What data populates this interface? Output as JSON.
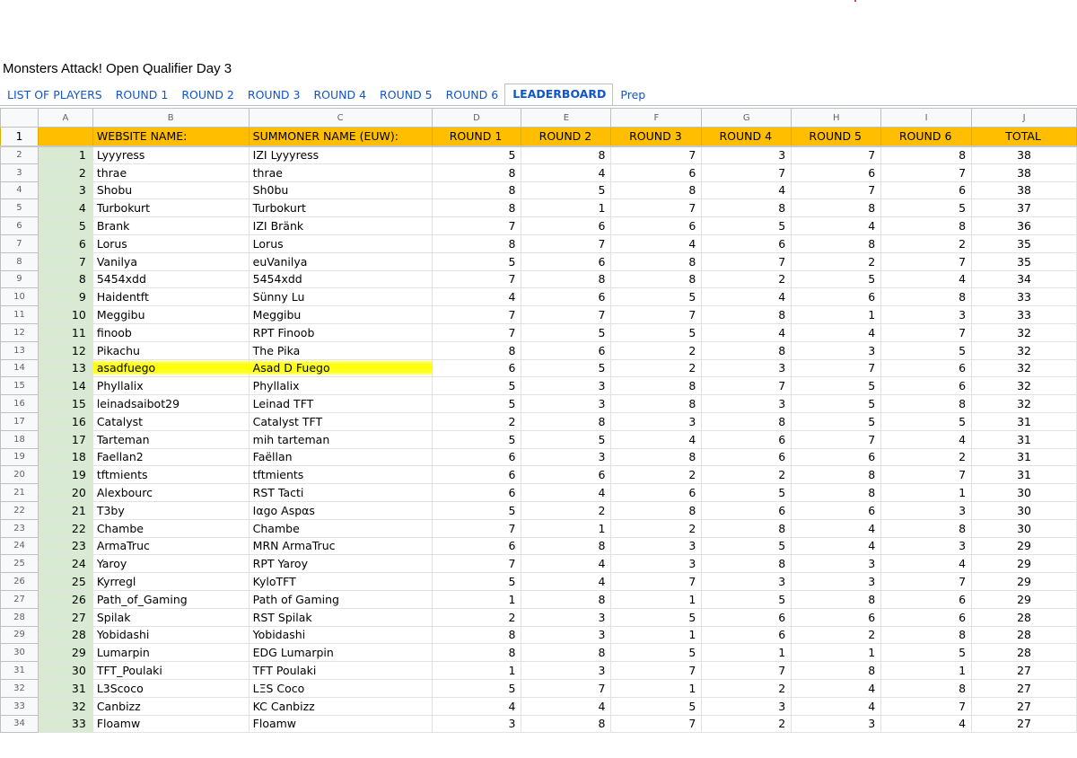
{
  "document": {
    "title": "Monsters Attack! Open Qualifier Day 3"
  },
  "tabs": [
    {
      "label": "LIST OF PLAYERS",
      "active": false
    },
    {
      "label": "ROUND 1",
      "active": false
    },
    {
      "label": "ROUND 2",
      "active": false
    },
    {
      "label": "ROUND 3",
      "active": false
    },
    {
      "label": "ROUND 4",
      "active": false
    },
    {
      "label": "ROUND 5",
      "active": false
    },
    {
      "label": "ROUND 6",
      "active": false
    },
    {
      "label": "LEADERBOARD",
      "active": true
    },
    {
      "label": "Prep",
      "active": false
    }
  ],
  "column_letters": [
    "A",
    "B",
    "C",
    "D",
    "E",
    "F",
    "G",
    "H",
    "I",
    "J"
  ],
  "headers": [
    "",
    "WEBSITE NAME:",
    "SUMMONER NAME (EUW):",
    "ROUND 1",
    "ROUND 2",
    "ROUND 3",
    "ROUND 4",
    "ROUND 5",
    "ROUND 6",
    "TOTAL"
  ],
  "highlight_color": "#ffff00",
  "header_color": "#ffbf00",
  "rank_color": "#d9ead3",
  "rows": [
    {
      "row": 2,
      "rank": 1,
      "website": "Lyyyress",
      "summoner": "IZI Lyyyress",
      "rounds": [
        5,
        8,
        7,
        3,
        7,
        8
      ],
      "total": 38
    },
    {
      "row": 3,
      "rank": 2,
      "website": "thrae",
      "summoner": "thrae",
      "rounds": [
        8,
        4,
        6,
        7,
        6,
        7
      ],
      "total": 38
    },
    {
      "row": 4,
      "rank": 3,
      "website": "Shobu",
      "summoner": "Sh0bu",
      "rounds": [
        8,
        5,
        8,
        4,
        7,
        6
      ],
      "total": 38
    },
    {
      "row": 5,
      "rank": 4,
      "website": "Turbokurt",
      "summoner": "Turbokurt",
      "rounds": [
        8,
        1,
        7,
        8,
        8,
        5
      ],
      "total": 37
    },
    {
      "row": 6,
      "rank": 5,
      "website": "Brank",
      "summoner": "IZI Bränk",
      "rounds": [
        7,
        6,
        6,
        5,
        4,
        8
      ],
      "total": 36
    },
    {
      "row": 7,
      "rank": 6,
      "website": "Lorus",
      "summoner": "Lorus",
      "rounds": [
        8,
        7,
        4,
        6,
        8,
        2
      ],
      "total": 35
    },
    {
      "row": 8,
      "rank": 7,
      "website": "Vanilya",
      "summoner": "euVanilya",
      "rounds": [
        5,
        6,
        8,
        7,
        2,
        7
      ],
      "total": 35
    },
    {
      "row": 9,
      "rank": 8,
      "website": "5454xdd",
      "summoner": "5454xdd",
      "rounds": [
        7,
        8,
        8,
        2,
        5,
        4
      ],
      "total": 34
    },
    {
      "row": 10,
      "rank": 9,
      "website": "Haidentft",
      "summoner": "Sünny Lu",
      "rounds": [
        4,
        6,
        5,
        4,
        6,
        8
      ],
      "total": 33
    },
    {
      "row": 11,
      "rank": 10,
      "website": "Meggibu",
      "summoner": "Meggibu",
      "rounds": [
        7,
        7,
        7,
        8,
        1,
        3
      ],
      "total": 33
    },
    {
      "row": 12,
      "rank": 11,
      "website": "finoob",
      "summoner": "RPT Finoob",
      "rounds": [
        7,
        5,
        5,
        4,
        4,
        7
      ],
      "total": 32
    },
    {
      "row": 13,
      "rank": 12,
      "website": "Pikachu",
      "summoner": "The Pika",
      "rounds": [
        8,
        6,
        2,
        8,
        3,
        5
      ],
      "total": 32
    },
    {
      "row": 14,
      "rank": 13,
      "website": "asadfuego",
      "summoner": "Asad D Fuego",
      "rounds": [
        6,
        5,
        2,
        3,
        7,
        6
      ],
      "total": 32,
      "highlight": true
    },
    {
      "row": 15,
      "rank": 14,
      "website": "Phyllalix",
      "summoner": "Phyllalix",
      "rounds": [
        5,
        3,
        8,
        7,
        5,
        6
      ],
      "total": 32
    },
    {
      "row": 16,
      "rank": 15,
      "website": "leinadsaibot29",
      "summoner": "Leinad TFT",
      "rounds": [
        5,
        3,
        8,
        3,
        5,
        8
      ],
      "total": 32
    },
    {
      "row": 17,
      "rank": 16,
      "website": "Catalyst",
      "summoner": "Catalyst TFT",
      "rounds": [
        2,
        8,
        3,
        8,
        5,
        5
      ],
      "total": 31
    },
    {
      "row": 18,
      "rank": 17,
      "website": "Tarteman",
      "summoner": "mih tarteman",
      "rounds": [
        5,
        5,
        4,
        6,
        7,
        4
      ],
      "total": 31
    },
    {
      "row": 19,
      "rank": 18,
      "website": "Faellan2",
      "summoner": "Faëllan",
      "rounds": [
        6,
        3,
        8,
        6,
        6,
        2
      ],
      "total": 31
    },
    {
      "row": 20,
      "rank": 19,
      "website": "tftmients",
      "summoner": "tftmients",
      "rounds": [
        6,
        6,
        2,
        2,
        8,
        7
      ],
      "total": 31
    },
    {
      "row": 21,
      "rank": 20,
      "website": "Alexbourc",
      "summoner": "RST Tacti",
      "rounds": [
        6,
        4,
        6,
        5,
        8,
        1
      ],
      "total": 30
    },
    {
      "row": 22,
      "rank": 21,
      "website": "T3by",
      "summoner": "Iαgo Aspαs",
      "rounds": [
        5,
        2,
        8,
        6,
        6,
        3
      ],
      "total": 30
    },
    {
      "row": 23,
      "rank": 22,
      "website": "Chambe",
      "summoner": "Chambe",
      "rounds": [
        7,
        1,
        2,
        8,
        4,
        8
      ],
      "total": 30
    },
    {
      "row": 24,
      "rank": 23,
      "website": "ArmaTruc",
      "summoner": "MRN ArmaTruc",
      "rounds": [
        6,
        8,
        3,
        5,
        4,
        3
      ],
      "total": 29
    },
    {
      "row": 25,
      "rank": 24,
      "website": "Yaroy",
      "summoner": "RPT Yaroy",
      "rounds": [
        7,
        4,
        3,
        8,
        3,
        4
      ],
      "total": 29
    },
    {
      "row": 26,
      "rank": 25,
      "website": "Kyrregl",
      "summoner": "KyloTFT",
      "rounds": [
        5,
        4,
        7,
        3,
        3,
        7
      ],
      "total": 29
    },
    {
      "row": 27,
      "rank": 26,
      "website": "Path_of_Gaming",
      "summoner": "Path of Gaming",
      "rounds": [
        1,
        8,
        1,
        5,
        8,
        6
      ],
      "total": 29
    },
    {
      "row": 28,
      "rank": 27,
      "website": "Spilak",
      "summoner": "RST Spilak",
      "rounds": [
        2,
        3,
        5,
        6,
        6,
        6
      ],
      "total": 28
    },
    {
      "row": 29,
      "rank": 28,
      "website": "Yobidashi",
      "summoner": "Yobidashi",
      "rounds": [
        8,
        3,
        1,
        6,
        2,
        8
      ],
      "total": 28
    },
    {
      "row": 30,
      "rank": 29,
      "website": "Lumarpin",
      "summoner": "EDG Lumarpin",
      "rounds": [
        8,
        8,
        5,
        1,
        1,
        5
      ],
      "total": 28
    },
    {
      "row": 31,
      "rank": 30,
      "website": "TFT_Poulaki",
      "summoner": "TFT Poulaki",
      "rounds": [
        1,
        3,
        7,
        7,
        8,
        1
      ],
      "total": 27
    },
    {
      "row": 32,
      "rank": 31,
      "website": "L3Scoco",
      "summoner": "LΞS Coco",
      "rounds": [
        5,
        7,
        1,
        2,
        4,
        8
      ],
      "total": 27
    },
    {
      "row": 33,
      "rank": 32,
      "website": "Canbizz",
      "summoner": "KC Canbizz",
      "rounds": [
        4,
        4,
        5,
        3,
        4,
        7
      ],
      "total": 27
    },
    {
      "row": 34,
      "rank": 33,
      "website": "Floamw",
      "summoner": "Floamw",
      "rounds": [
        3,
        8,
        7,
        2,
        3,
        4
      ],
      "total": 27
    }
  ]
}
